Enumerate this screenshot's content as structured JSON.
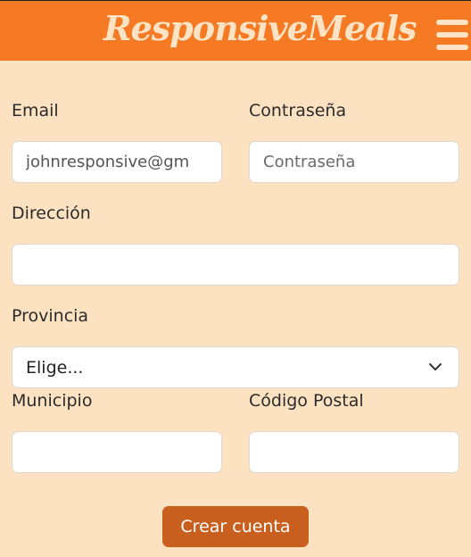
{
  "header": {
    "brand": "ResponsiveMeals",
    "menu_icon": "hamburger-menu-icon",
    "bg_color": "#f57a23"
  },
  "form": {
    "email": {
      "label": "Email",
      "value": "johnresponsive@gm"
    },
    "password": {
      "label": "Contraseña",
      "placeholder": "Contraseña"
    },
    "address": {
      "label": "Dirección",
      "value": ""
    },
    "province": {
      "label": "Provincia",
      "selected": "Elige..."
    },
    "municipality": {
      "label": "Municipio",
      "value": ""
    },
    "postal_code": {
      "label": "Código Postal",
      "value": ""
    },
    "submit_label": "Crear cuenta",
    "submit_color": "#c95f1e"
  }
}
